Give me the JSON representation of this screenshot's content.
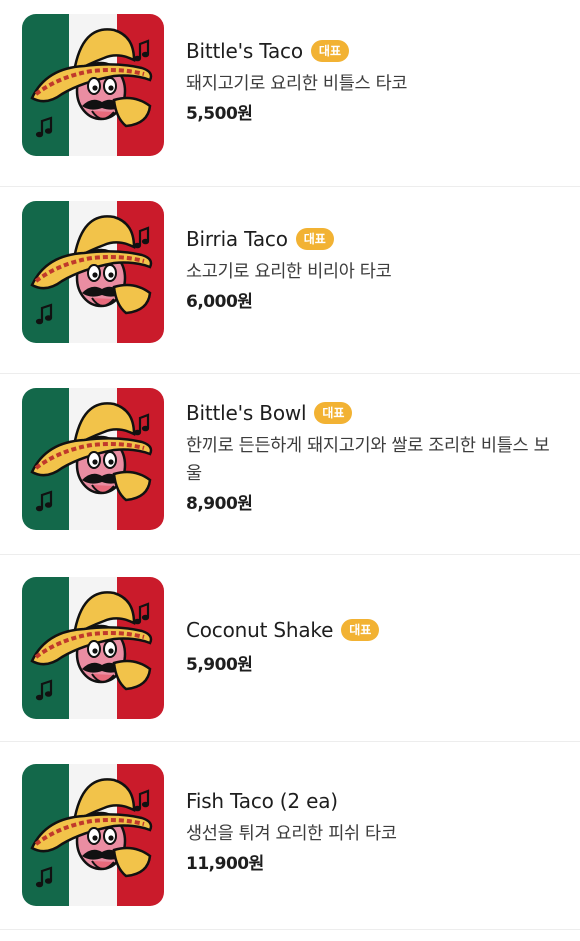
{
  "colors": {
    "badge": "#f2b233",
    "flag_green": "#13684a",
    "flag_white": "#f4f4f4",
    "flag_red": "#ca1b2b"
  },
  "items": [
    {
      "name": "Bittle's Taco",
      "badge": "대표",
      "description": "돼지고기로 요리한 비틀스 타코",
      "price": "5,500원",
      "image_icon": "bittle-taco-mascot-logo"
    },
    {
      "name": "Birria Taco",
      "badge": "대표",
      "description": "소고기로 요리한 비리아 타코",
      "price": "6,000원",
      "image_icon": "bittle-taco-mascot-logo"
    },
    {
      "name": "Bittle's Bowl",
      "badge": "대표",
      "description": "한끼로 든든하게 돼지고기와 쌀로 조리한 비틀스 보울",
      "price": "8,900원",
      "image_icon": "bittle-taco-mascot-logo"
    },
    {
      "name": "Coconut Shake",
      "badge": "대표",
      "description": "",
      "price": "5,900원",
      "image_icon": "bittle-taco-mascot-logo"
    },
    {
      "name": "Fish Taco (2 ea)",
      "badge": "",
      "description": "생선을 튀겨 요리한 피쉬 타코",
      "price": "11,900원",
      "image_icon": "bittle-taco-mascot-logo"
    }
  ]
}
